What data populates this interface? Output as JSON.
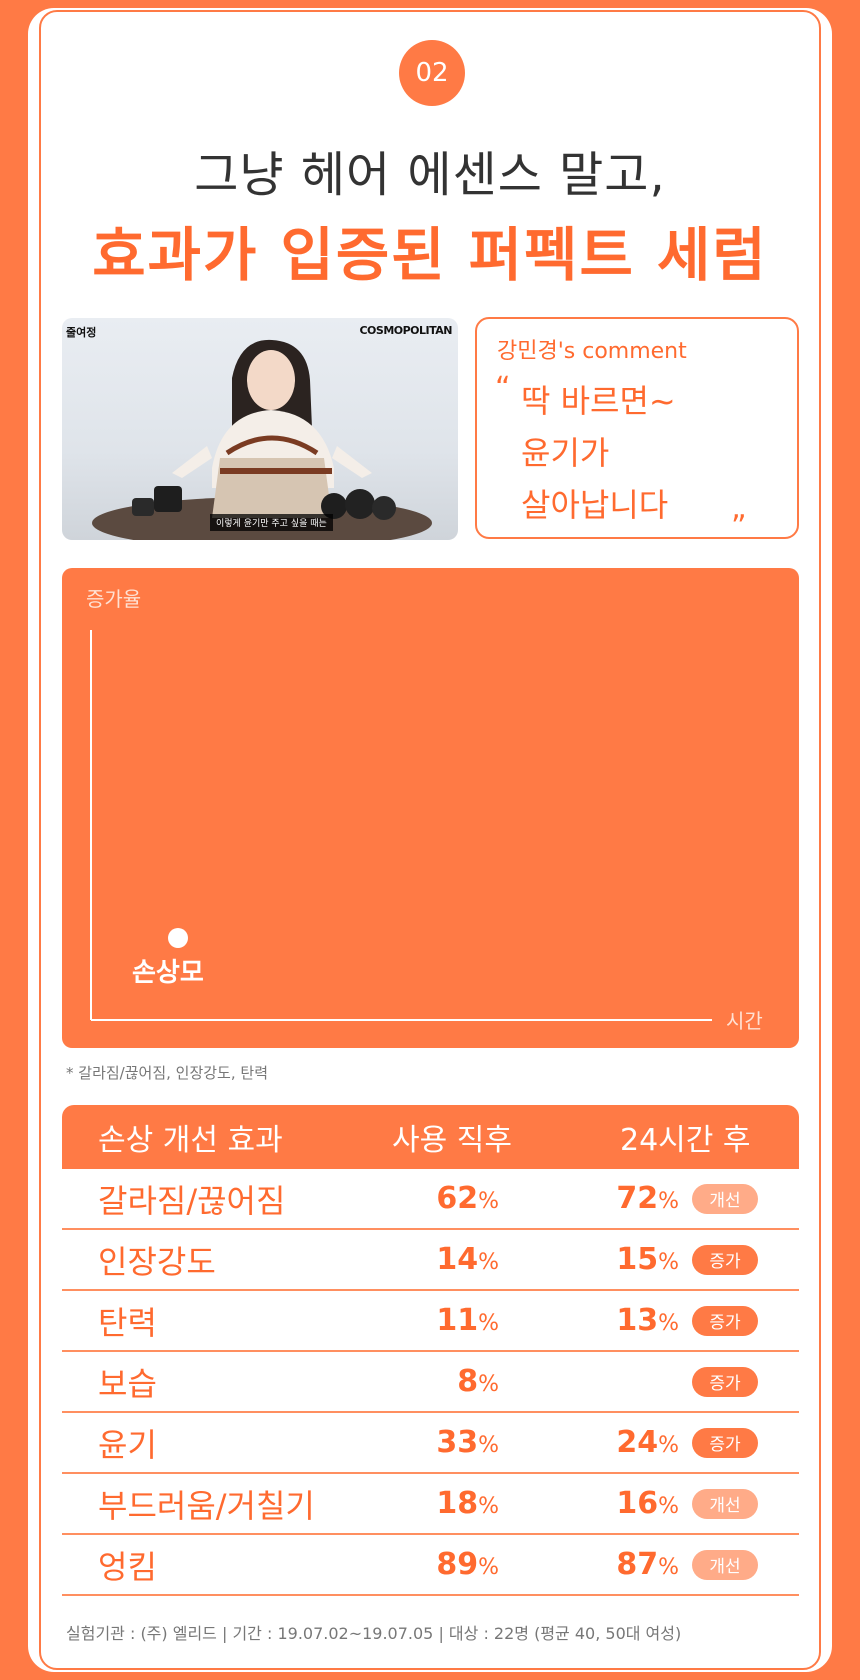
{
  "header": {
    "badge": "02",
    "title_line1": "그냥 헤어 에센스 말고,",
    "title_line2": "효과가 입증된 퍼펙트 세럼"
  },
  "photo": {
    "channel_tag": "줄여정",
    "brand": "COSMOPOLITAN",
    "caption": "이렇게 윤기만 주고 싶을 때는"
  },
  "comment": {
    "title": "강민경's comment",
    "open_quote": "“",
    "close_quote": "„",
    "lines": [
      "딱 바르면~",
      "윤기가",
      "살아납니다"
    ]
  },
  "chart_data": {
    "type": "line",
    "ylabel": "증가율",
    "xlabel": "시간",
    "points": [
      {
        "label": "손상모"
      }
    ],
    "series": []
  },
  "colors": {
    "accent": "#ff7a45",
    "accent_light": "#ffab88",
    "text_dark": "#333333"
  },
  "notes": "* 갈라짐/끊어짐, 인장강도, 탄력",
  "table": {
    "headers": [
      "손상 개선 효과",
      "사용 직후",
      "24시간 후"
    ],
    "rows": [
      {
        "label": "갈라짐/끊어짐",
        "v1": "62",
        "v1_unit": "%",
        "v2": "72",
        "v2_unit": "%",
        "tag": "개선",
        "tag_style": "light"
      },
      {
        "label": "인장강도",
        "v1": "14",
        "v1_unit": "%",
        "v2": "15",
        "v2_unit": "%",
        "tag": "증가",
        "tag_style": "solid"
      },
      {
        "label": "탄력",
        "v1": "11",
        "v1_unit": "%",
        "v2": "13",
        "v2_unit": "%",
        "tag": "증가",
        "tag_style": "solid"
      },
      {
        "label": "보습",
        "v1": "8",
        "v1_unit": "%",
        "v2": "",
        "v2_unit": "",
        "tag": "증가",
        "tag_style": "solid"
      },
      {
        "label": "윤기",
        "v1": "33",
        "v1_unit": "%",
        "v2": "24",
        "v2_unit": "%",
        "tag": "증가",
        "tag_style": "solid"
      },
      {
        "label": "부드러움/거칠기",
        "v1": "18",
        "v1_unit": "%",
        "v2": "16",
        "v2_unit": "%",
        "tag": "개선",
        "tag_style": "light"
      },
      {
        "label": "엉킴",
        "v1": "89",
        "v1_unit": "%",
        "v2": "87",
        "v2_unit": "%",
        "tag": "개선",
        "tag_style": "light"
      }
    ]
  },
  "footer": "실험기관 : (주) 엘리드  |  기간 : 19.07.02~19.07.05  |  대상 : 22명 (평균 40, 50대 여성)"
}
